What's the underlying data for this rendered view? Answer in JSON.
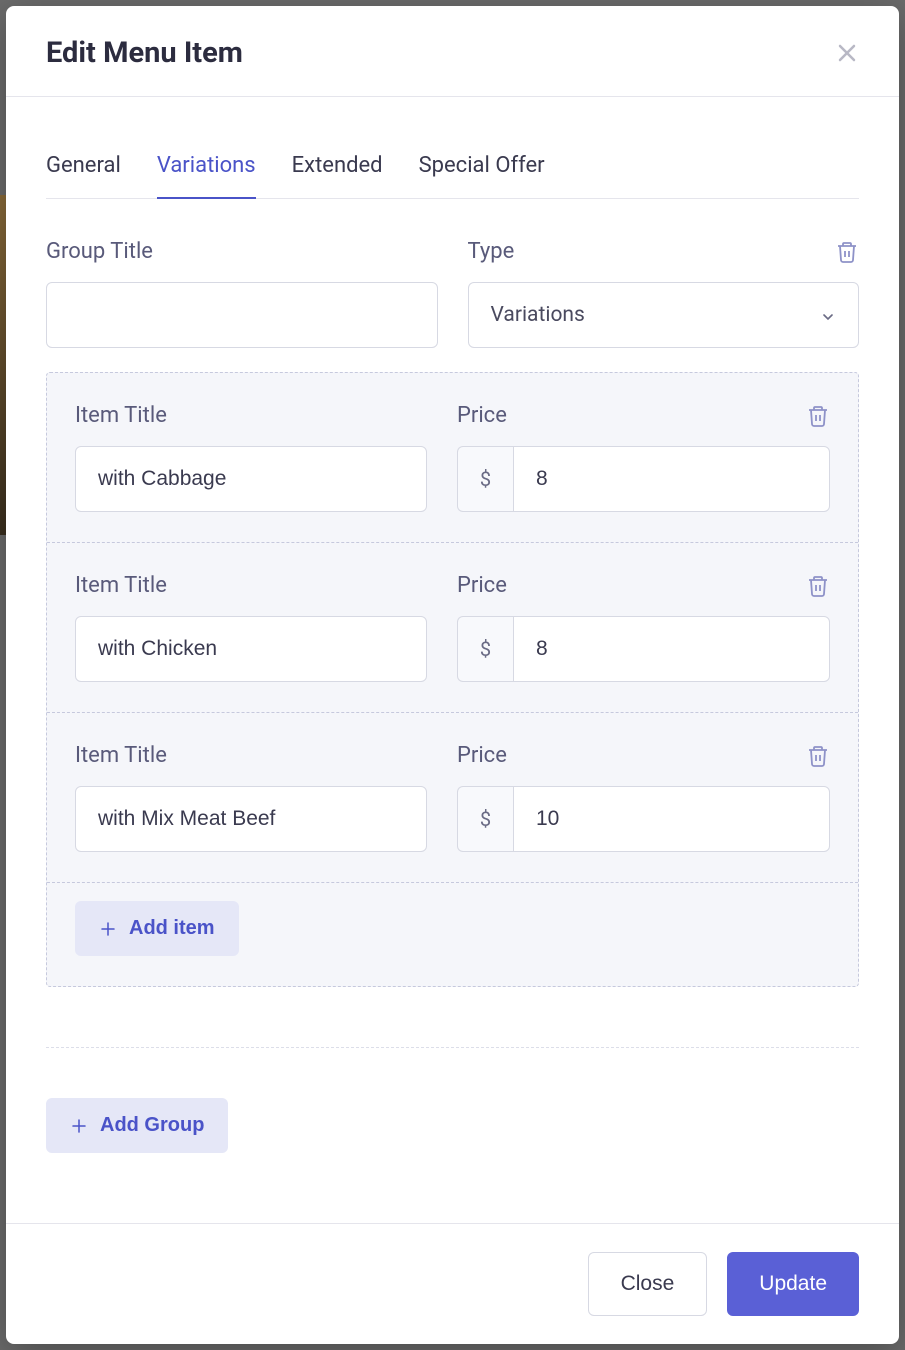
{
  "modal": {
    "title": "Edit Menu Item"
  },
  "tabs": {
    "general": "General",
    "variations": "Variations",
    "extended": "Extended",
    "special_offer": "Special Offer"
  },
  "group": {
    "title_label": "Group Title",
    "title_value": "",
    "type_label": "Type",
    "type_value": "Variations"
  },
  "item_labels": {
    "item_title": "Item Title",
    "price": "Price",
    "currency": "$"
  },
  "items": [
    {
      "title": "with Cabbage",
      "price": "8"
    },
    {
      "title": "with Chicken",
      "price": "8"
    },
    {
      "title": "with Mix Meat Beef",
      "price": "10"
    }
  ],
  "buttons": {
    "add_item": "Add item",
    "add_group": "Add Group",
    "close": "Close",
    "update": "Update"
  }
}
